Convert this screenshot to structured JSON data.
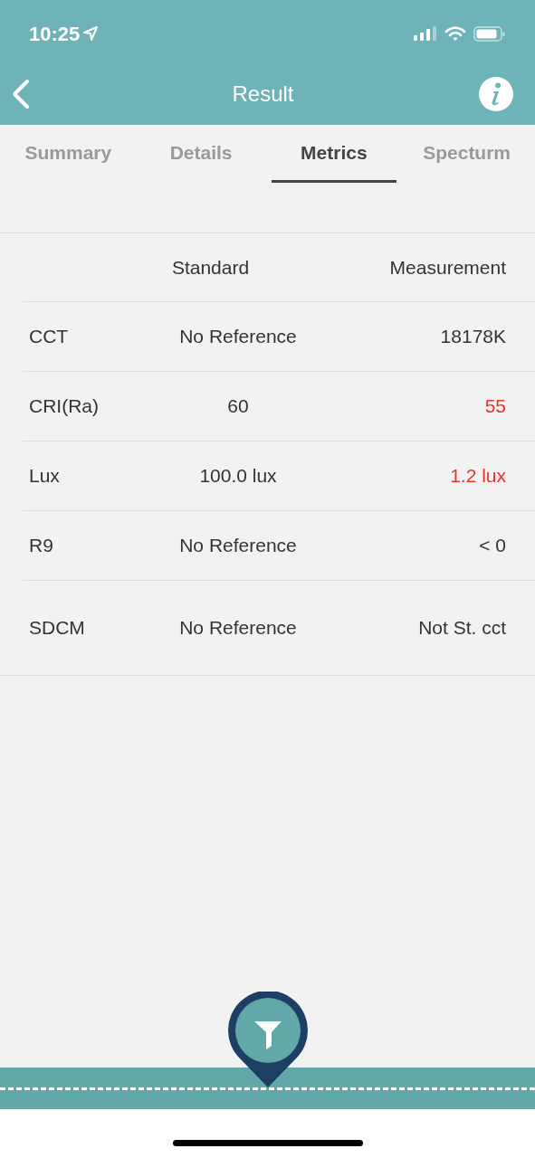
{
  "status_bar": {
    "time": "10:25"
  },
  "header": {
    "title": "Result"
  },
  "tabs": [
    {
      "label": "Summary",
      "selected": false
    },
    {
      "label": "Details",
      "selected": false
    },
    {
      "label": "Metrics",
      "selected": true
    },
    {
      "label": "Specturm",
      "selected": false
    }
  ],
  "table": {
    "columns": [
      "Standard",
      "Measurement"
    ],
    "rows": [
      {
        "label": "CCT",
        "standard": "No Reference",
        "measurement": "18178K",
        "failed": false
      },
      {
        "label": "CRI(Ra)",
        "standard": "60",
        "measurement": "55",
        "failed": true
      },
      {
        "label": "Lux",
        "standard": "100.0 lux",
        "measurement": "1.2 lux",
        "failed": true
      },
      {
        "label": "R9",
        "standard": "No Reference",
        "measurement": "< 0",
        "failed": false
      },
      {
        "label": "SDCM",
        "standard": "No Reference",
        "measurement": "Not St. cct",
        "failed": false
      }
    ]
  }
}
